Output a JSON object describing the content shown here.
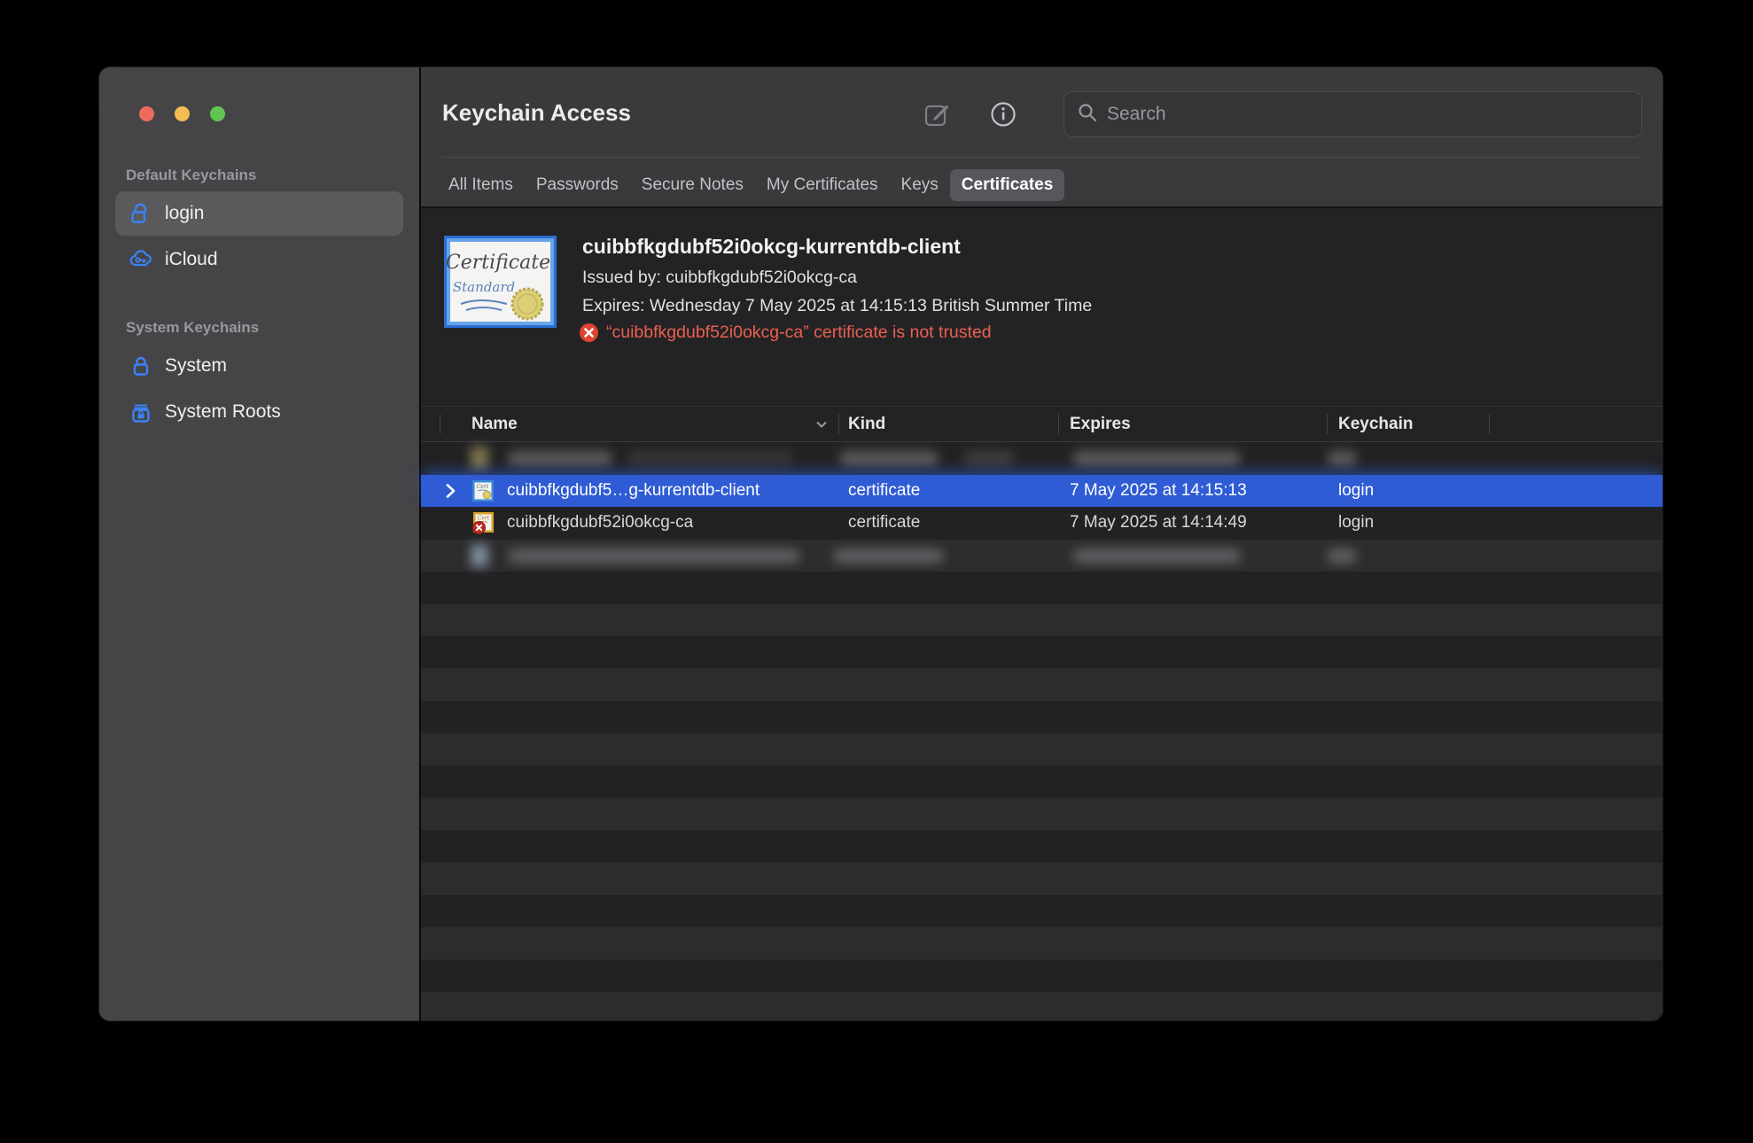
{
  "window": {
    "title": "Keychain Access",
    "search": {
      "placeholder": "Search",
      "value": ""
    }
  },
  "sidebar": {
    "sections": [
      {
        "header": "Default Keychains",
        "items": [
          {
            "label": "login",
            "icon": "unlocked-padlock-icon",
            "selected": true
          },
          {
            "label": "iCloud",
            "icon": "icloud-key-icon",
            "selected": false
          }
        ]
      },
      {
        "header": "System Keychains",
        "items": [
          {
            "label": "System",
            "icon": "locked-padlock-icon",
            "selected": false
          },
          {
            "label": "System Roots",
            "icon": "lockbox-icon",
            "selected": false
          }
        ]
      }
    ]
  },
  "tabs": [
    {
      "label": "All Items",
      "selected": false
    },
    {
      "label": "Passwords",
      "selected": false
    },
    {
      "label": "Secure Notes",
      "selected": false
    },
    {
      "label": "My Certificates",
      "selected": false
    },
    {
      "label": "Keys",
      "selected": false
    },
    {
      "label": "Certificates",
      "selected": true
    }
  ],
  "detail": {
    "title": "cuibbfkgdubf52i0okcg-kurrentdb-client",
    "issued_by": "Issued by: cuibbfkgdubf52i0okcg-ca",
    "expires": "Expires: Wednesday 7 May 2025 at 14:15:13 British Summer Time",
    "warning": "“cuibbfkgdubf52i0okcg-ca” certificate is not trusted",
    "cert_badge_title": "Certificate",
    "cert_badge_subtitle": "Standard"
  },
  "table": {
    "columns": [
      "Name",
      "Kind",
      "Expires",
      "Keychain"
    ],
    "rows": [
      {
        "redacted": true
      },
      {
        "name": "cuibbfkgdubf5…g-kurrentdb-client",
        "kind": "certificate",
        "expires": "7 May 2025 at 14:15:13",
        "keychain": "login",
        "selected": true,
        "icon": "certificate-icon"
      },
      {
        "name": "cuibbfkgdubf52i0okcg-ca",
        "kind": "certificate",
        "expires": "7 May 2025 at 14:14:49",
        "keychain": "login",
        "selected": false,
        "icon": "certificate-untrusted-icon"
      },
      {
        "redacted": true
      }
    ]
  },
  "colors": {
    "selection_blue": "#2f5cd4",
    "accent_blue": "#3b82f7",
    "warning_red": "#ec5f4f",
    "traffic_close": "#ee6a5f",
    "traffic_minimize": "#f5bd4f",
    "traffic_zoom": "#61c554"
  }
}
